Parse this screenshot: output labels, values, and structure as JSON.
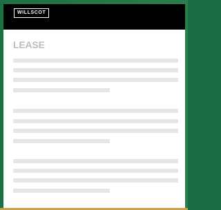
{
  "colors": {
    "side_accent": "#1e6f44",
    "bottom_accent": "#c9a14a",
    "header_background": "#000000",
    "title_color": "#bdbdbd",
    "skeleton_color": "#e6e6e6"
  },
  "header": {
    "logo_text": "WILLSCOT"
  },
  "main": {
    "title": "LEASE",
    "loading_state": "skeleton-placeholder-lines"
  }
}
